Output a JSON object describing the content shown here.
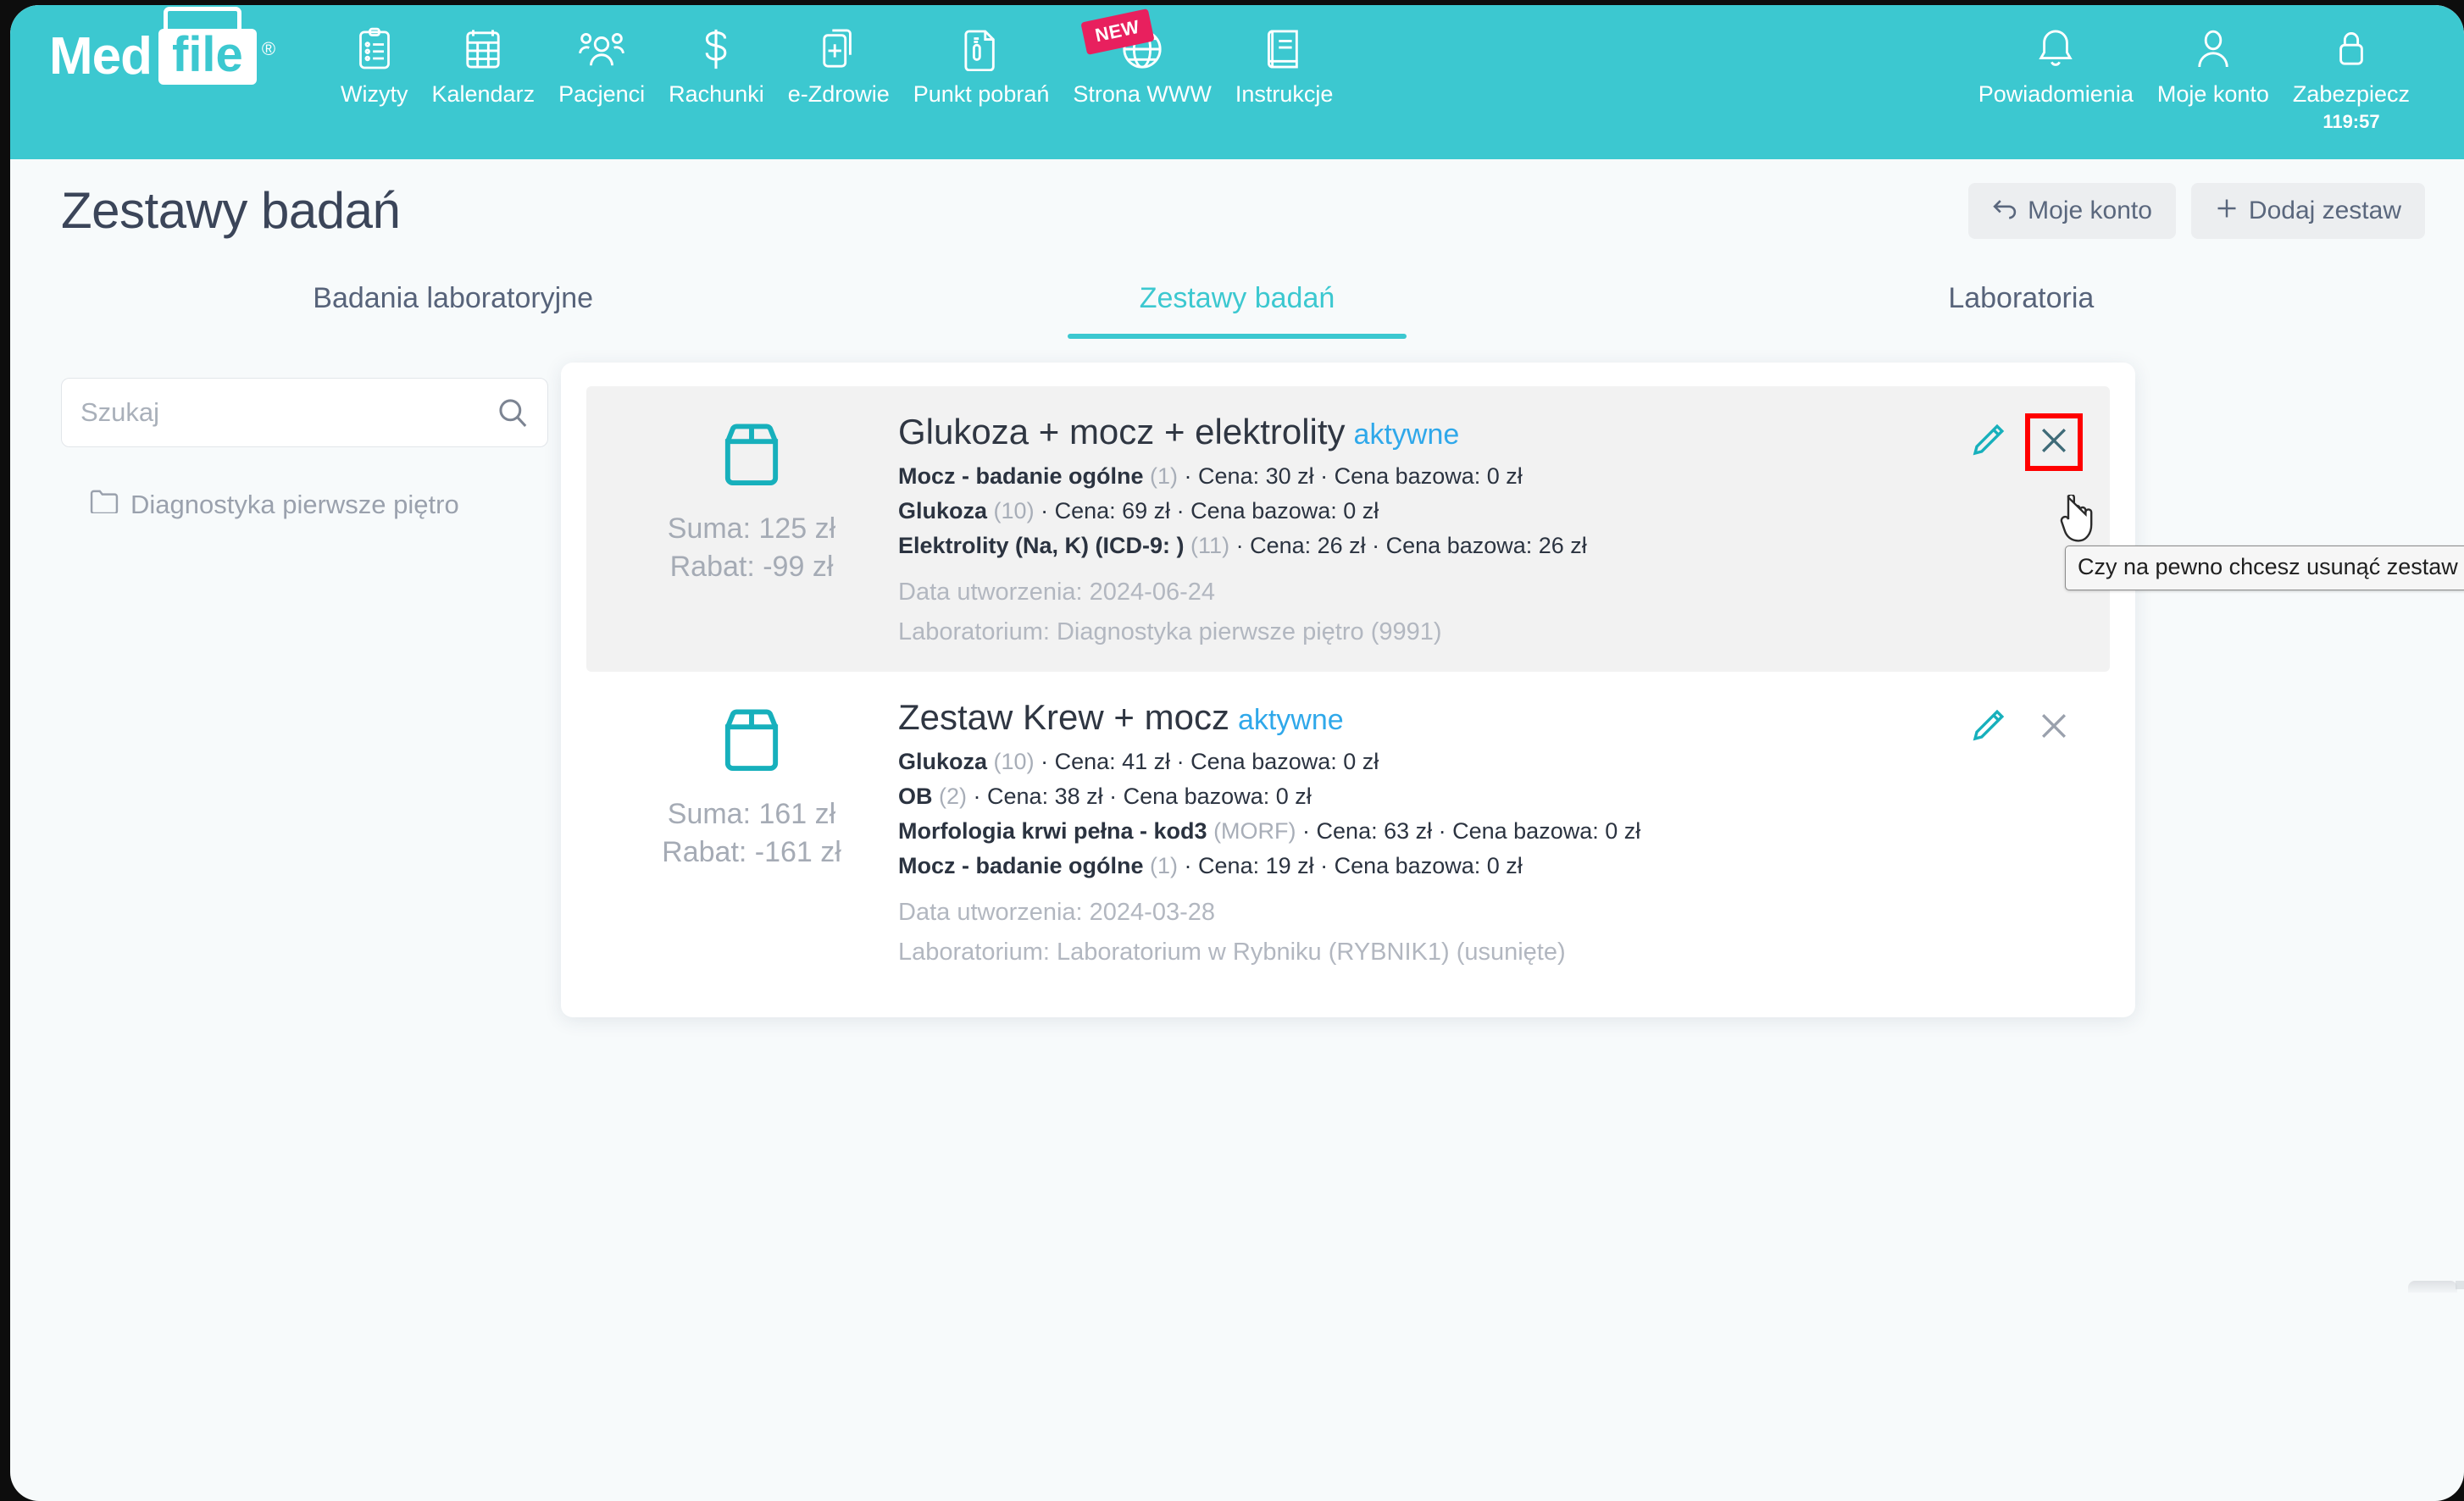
{
  "header": {
    "brand": {
      "med": "Med",
      "file": "file",
      "registered": "®"
    },
    "nav_left": [
      {
        "label": "Wizyty",
        "icon": "clipboard-icon"
      },
      {
        "label": "Kalendarz",
        "icon": "calendar-icon"
      },
      {
        "label": "Pacjenci",
        "icon": "patients-icon"
      },
      {
        "label": "Rachunki",
        "icon": "dollar-icon"
      },
      {
        "label": "e-Zdrowie",
        "icon": "health-card-icon"
      },
      {
        "label": "Punkt pobrań",
        "icon": "test-tube-document-icon"
      },
      {
        "label": "Strona WWW",
        "icon": "globe-icon",
        "badge": "NEW"
      },
      {
        "label": "Instrukcje",
        "icon": "book-icon"
      }
    ],
    "nav_right": [
      {
        "label": "Powiadomienia",
        "icon": "bell-icon"
      },
      {
        "label": "Moje konto",
        "icon": "user-icon"
      },
      {
        "label": "Zabezpiecz",
        "icon": "lock-icon",
        "sub": "119:57"
      }
    ]
  },
  "title_bar": {
    "title": "Zestawy badań",
    "my_account_button": "Moje konto",
    "my_account_icon": "back-arrow-icon",
    "add_set_button": "Dodaj zestaw",
    "add_set_icon": "plus-icon"
  },
  "tabs": [
    {
      "label": "Badania laboratoryjne",
      "active": false
    },
    {
      "label": "Zestawy badań",
      "active": true
    },
    {
      "label": "Laboratoria",
      "active": false
    }
  ],
  "sidebar": {
    "search_placeholder": "Szukaj",
    "search_value": "",
    "search_icon": "search-icon",
    "folders": [
      {
        "label": "Diagnostyka pierwsze piętro",
        "icon": "folder-icon"
      }
    ]
  },
  "sets": [
    {
      "package_icon": "package-box-icon",
      "sum_label": "Suma: 125 zł",
      "discount_label": "Rabat: -99 zł",
      "title": "Glukoza + mocz + elektrolity",
      "status": "aktywne",
      "tests": [
        {
          "name": "Mocz - badanie ogólne",
          "code": "(1)",
          "price": "· Cena: 30 zł · Cena bazowa: 0 zł"
        },
        {
          "name": "Glukoza",
          "code": "(10)",
          "price": "· Cena: 69 zł · Cena bazowa: 0 zł"
        },
        {
          "name": "Elektrolity (Na, K) (ICD-9: )",
          "code": "(11)",
          "price": "· Cena: 26 zł · Cena bazowa: 26 zł"
        }
      ],
      "created": "Data utworzenia: 2024-06-24",
      "laboratory": "Laboratorium: Diagnostyka pierwsze piętro (9991)",
      "edit_icon": "pencil-icon",
      "delete_icon": "close-x-icon",
      "highlighted": true,
      "delete_focused": true
    },
    {
      "package_icon": "package-box-icon",
      "sum_label": "Suma: 161 zł",
      "discount_label": "Rabat: -161 zł",
      "title": "Zestaw Krew + mocz",
      "status": "aktywne",
      "tests": [
        {
          "name": "Glukoza",
          "code": "(10)",
          "price": "· Cena: 41 zł · Cena bazowa: 0 zł"
        },
        {
          "name": "OB",
          "code": "(2)",
          "price": "· Cena: 38 zł · Cena bazowa: 0 zł"
        },
        {
          "name": "Morfologia krwi pełna - kod3",
          "code": "(MORF)",
          "price": "· Cena: 63 zł · Cena bazowa: 0 zł"
        },
        {
          "name": "Mocz - badanie ogólne",
          "code": "(1)",
          "price": "· Cena: 19 zł · Cena bazowa: 0 zł"
        }
      ],
      "created": "Data utworzenia: 2024-03-28",
      "laboratory": "Laboratorium: Laboratorium w Rybniku (RYBNIK1) (usunięte)",
      "edit_icon": "pencil-icon",
      "delete_icon": "close-x-icon",
      "highlighted": false,
      "delete_focused": false
    }
  ],
  "tooltip": {
    "text": "Czy na pewno chcesz usunąć zestaw badań?"
  },
  "colors": {
    "brand_teal": "#3cc8d0",
    "accent_teal": "#17b0bc",
    "status_blue": "#2fa8ea",
    "badge_pink": "#e8205e",
    "focus_red": "#ff0000",
    "page_bg": "#f7fafb"
  }
}
